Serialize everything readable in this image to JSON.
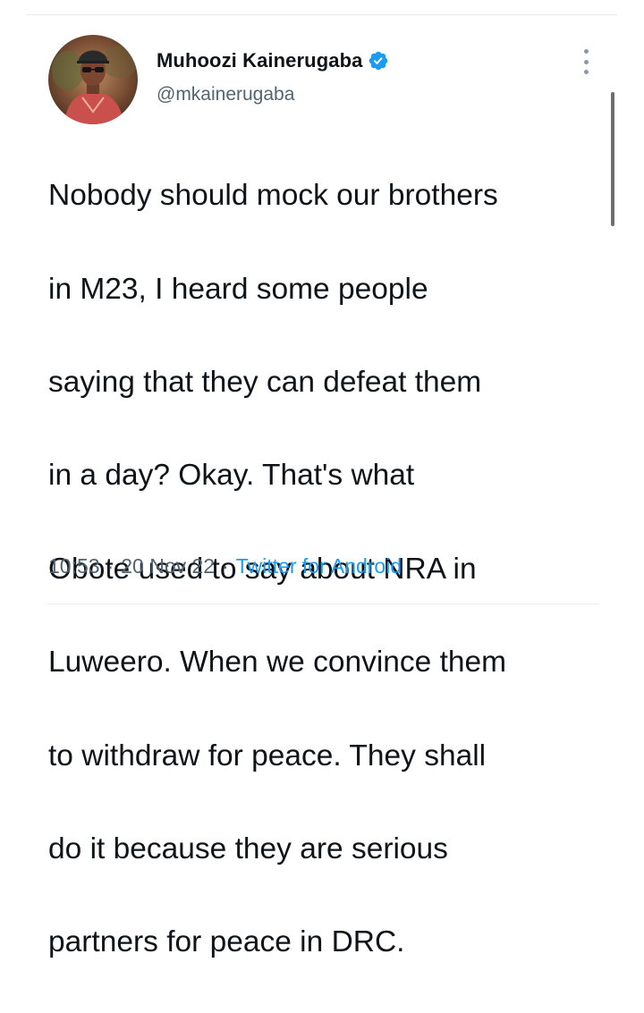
{
  "author": {
    "display_name": "Muhoozi Kainerugaba",
    "handle": "@mkainerugaba",
    "verified": true
  },
  "tweet": {
    "lines": [
      "Nobody should mock our brothers",
      "in M23, I heard some people",
      "saying that they can defeat them",
      "in a day? Okay. That's what",
      "Obote used to say about NRA in",
      "Luweero. When we convince them",
      "to withdraw for peace. They shall",
      "do it because they are serious",
      "partners for peace in DRC."
    ]
  },
  "meta": {
    "time": "10:53",
    "separator": "·",
    "date": "20 Nov 22",
    "source": "Twitter for Android"
  },
  "icons": {
    "verified": "verified-badge-icon",
    "more": "more-vertical-icon"
  },
  "colors": {
    "accent": "#1d9bf0",
    "text": "#0f1419",
    "muted": "#536471",
    "divider": "#e7e9ea"
  }
}
